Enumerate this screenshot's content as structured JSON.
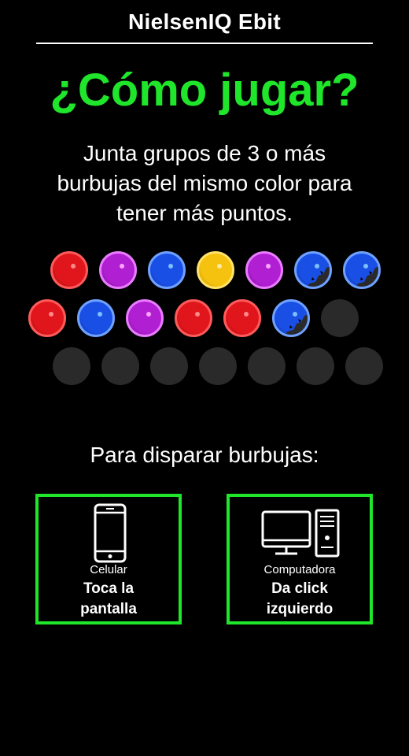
{
  "header": {
    "brand": "NielsenIQ Ebit"
  },
  "title": "¿Cómo jugar?",
  "intro": "Junta grupos de 3 o más burbujas del mismo color para tener más puntos.",
  "colors": {
    "accent_green": "#1fe62a",
    "red": "#e3161c",
    "purple": "#b01fd2",
    "blue": "#1a4fe6",
    "yellow": "#f4c20f",
    "empty": "#2a2a2a"
  },
  "bubble_rows": [
    [
      "red",
      "purple",
      "blue",
      "yellow",
      "purple",
      "blue-popping",
      "blue-popping"
    ],
    [
      "red",
      "blue",
      "purple",
      "red",
      "red",
      "blue-popping",
      "empty"
    ],
    [
      "empty",
      "empty",
      "empty",
      "empty",
      "empty",
      "empty",
      "empty"
    ]
  ],
  "fire": {
    "label": "Para disparar burbujas:"
  },
  "options": [
    {
      "icon": "smartphone-icon",
      "device": "Celular",
      "action": "Toca la\npantalla"
    },
    {
      "icon": "desktop-computer-icon",
      "device": "Computadora",
      "action": "Da click\nizquierdo"
    }
  ]
}
